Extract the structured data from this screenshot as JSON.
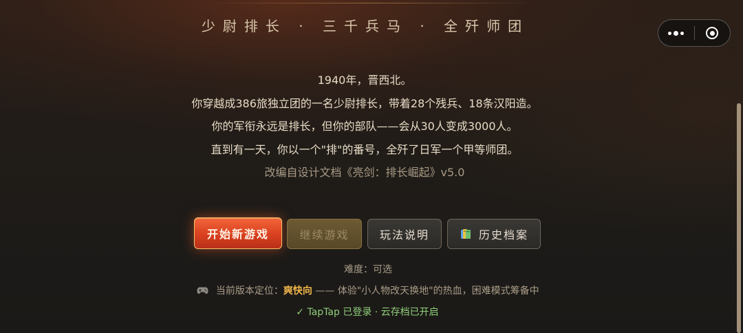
{
  "header": {
    "tagline": "少尉排长 · 三千兵马 · 全歼师团"
  },
  "story": {
    "lines": [
      "1940年，晋西北。",
      "你穿越成386旅独立团的一名少尉排长，带着28个残兵、18条汉阳造。",
      "你的军衔永远是排长，但你的部队——会从30人变成3000人。",
      "直到有一天，你以一个\"排\"的番号，全歼了日军一个甲等师团。"
    ],
    "source": "改编自设计文档《亮剑：排长崛起》v5.0"
  },
  "buttons": {
    "new_game": "开始新游戏",
    "continue": "继续游戏",
    "how_to_play": "玩法说明",
    "history": "历史档案"
  },
  "difficulty": "难度：可选",
  "version_info": {
    "prefix": "当前版本定位：",
    "highlight": "爽快向",
    "suffix": "—— 体验\"小人物改天换地\"的热血，困难模式筹备中"
  },
  "login_status": "✓ TapTap 已登录 · 云存档已开启",
  "icons": {
    "more": "more-dots-icon",
    "close": "close-circle-icon",
    "history": "book-icon",
    "version": "gamepad-icon"
  },
  "colors": {
    "accent": "#e5542c",
    "highlight": "#f0b64a",
    "success": "#8fcf7a"
  }
}
